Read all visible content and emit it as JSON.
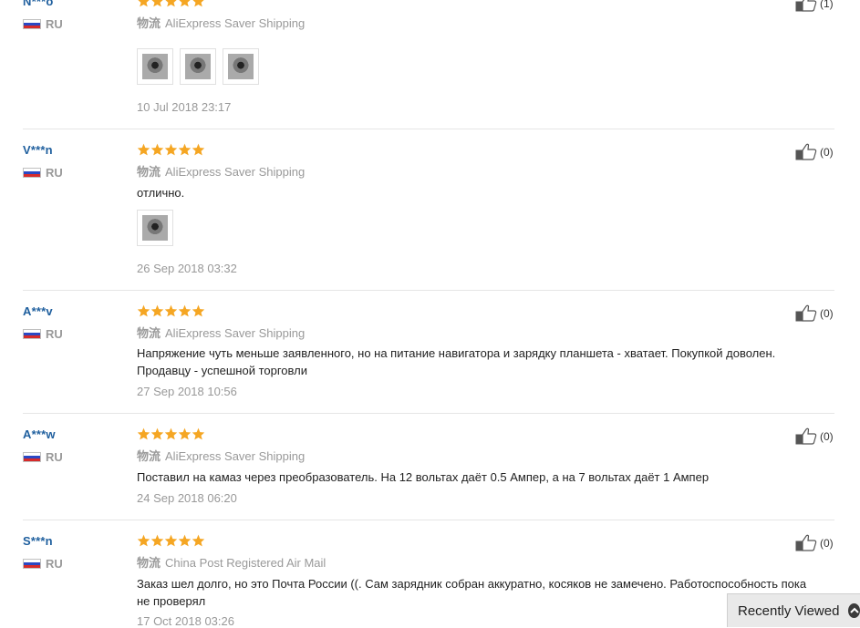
{
  "reviews": [
    {
      "user": "N***o",
      "country": "RU",
      "rating": 5,
      "shipping_label": "物流",
      "shipping_method": "AliExpress Saver Shipping",
      "text": "",
      "photos": 3,
      "date": "10 Jul 2018 23:17",
      "likes": "(1)"
    },
    {
      "user": "V***n",
      "country": "RU",
      "rating": 5,
      "shipping_label": "物流",
      "shipping_method": "AliExpress Saver Shipping",
      "text": "отлично.",
      "photos": 1,
      "date": "26 Sep 2018 03:32",
      "likes": "(0)"
    },
    {
      "user": "A***v",
      "country": "RU",
      "rating": 5,
      "shipping_label": "物流",
      "shipping_method": "AliExpress Saver Shipping",
      "text": "Напряжение чуть меньше заявленного, но на питание навигатора и зарядку планшета - хватает. Покупкой доволен. Продавцу - успешной торговли",
      "photos": 0,
      "date": "27 Sep 2018 10:56",
      "likes": "(0)"
    },
    {
      "user": "A***w",
      "country": "RU",
      "rating": 5,
      "shipping_label": "物流",
      "shipping_method": "AliExpress Saver Shipping",
      "text": "Поставил на камаз через преобразователь. На 12 вольтах даёт 0.5 Ампер, а на 7 вольтах даёт 1 Ампер",
      "photos": 0,
      "date": "24 Sep 2018 06:20",
      "likes": "(0)"
    },
    {
      "user": "S***n",
      "country": "RU",
      "rating": 5,
      "shipping_label": "物流",
      "shipping_method": "China Post Registered Air Mail",
      "text": "Заказ шел долго, но это Почта России ((. Сам зарядник собран аккуратно, косяков не замечено. Работоспособность пока не проверял",
      "photos": 0,
      "date": "17 Oct 2018 03:26",
      "likes": "(0)"
    }
  ],
  "recently_viewed": {
    "label": "Recently Viewed"
  },
  "colors": {
    "star": "#f5a623",
    "username": "#1f5f9e",
    "muted": "#999999"
  },
  "icons": {
    "like": "thumbs-up-icon",
    "star": "star-icon",
    "flag": "russia-flag-icon",
    "toggle": "chevron-up-icon"
  }
}
